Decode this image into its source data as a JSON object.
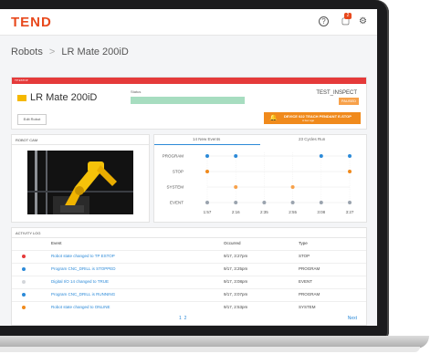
{
  "app": {
    "logo": "TEND"
  },
  "header": {
    "help_icon": "?",
    "bell_icon": "▢",
    "notification_count": "2",
    "gear_icon": "⚙"
  },
  "breadcrumb": {
    "root": "Robots",
    "separator": ">",
    "current": "LR Mate 200iD"
  },
  "robot": {
    "alert_strip": "TP ESTOP",
    "name": "LR Mate 200iD",
    "status_label": "Status",
    "state": "TEST_INSPECT",
    "state_badge": "PAUSED",
    "edit_label": "Edit Robot",
    "alert_title": "DEVICE 022 TEACH PENDANT E-STOP",
    "alert_sub": "A few ago",
    "colors": {
      "alert": "#e53a3a",
      "status": "#a7ddc0",
      "badge": "#f7a14a",
      "alert_button": "#f08a1c"
    }
  },
  "cam": {
    "title": "ROBOT CAM"
  },
  "events": {
    "tabs": [
      "14 New Events",
      "23 Cycles Run"
    ],
    "chart_data": {
      "type": "scatter",
      "y_categories": [
        "PROGRAM",
        "STOP",
        "SYSTEM",
        "EVENT"
      ],
      "x_ticks": [
        "1:57",
        "2:16",
        "2:35",
        "2:55",
        "3:08",
        "3:27"
      ],
      "series": [
        {
          "category": "PROGRAM",
          "color": "#2c8ad8",
          "x": [
            0,
            1,
            4,
            5
          ]
        },
        {
          "category": "STOP",
          "color": "#f08a1c",
          "x": [
            0,
            5
          ]
        },
        {
          "category": "SYSTEM",
          "color": "#f7a14a",
          "x": [
            1,
            3
          ]
        },
        {
          "category": "EVENT",
          "color": "#9aa3ae",
          "x": [
            0,
            1,
            2,
            3,
            4,
            5
          ]
        }
      ]
    }
  },
  "log": {
    "title": "ACTIVITY LOG",
    "columns": [
      "Event",
      "Occurred",
      "Type"
    ],
    "rows": [
      {
        "event": "Robot state changed to TP ESTOP",
        "occurred": "9/17, 3:27pm",
        "type": "STOP",
        "color": "#e53a3a"
      },
      {
        "event": "Program CNC_DRILL is STOPPED",
        "occurred": "9/17, 3:25pm",
        "type": "PROGRAM",
        "color": "#2c8ad8"
      },
      {
        "event": "Digital I/O 14 changed to TRUE",
        "occurred": "9/17, 3:08pm",
        "type": "EVENT",
        "color": "#d3d6da"
      },
      {
        "event": "Program CNC_DRILL is RUNNING",
        "occurred": "9/17, 3:07pm",
        "type": "PROGRAM",
        "color": "#2c8ad8"
      },
      {
        "event": "Robot state changed to ONLINE",
        "occurred": "9/17, 2:53pm",
        "type": "SYSTEM",
        "color": "#f08a1c"
      }
    ],
    "pages": [
      "1",
      "2"
    ],
    "next_label": "Next"
  }
}
